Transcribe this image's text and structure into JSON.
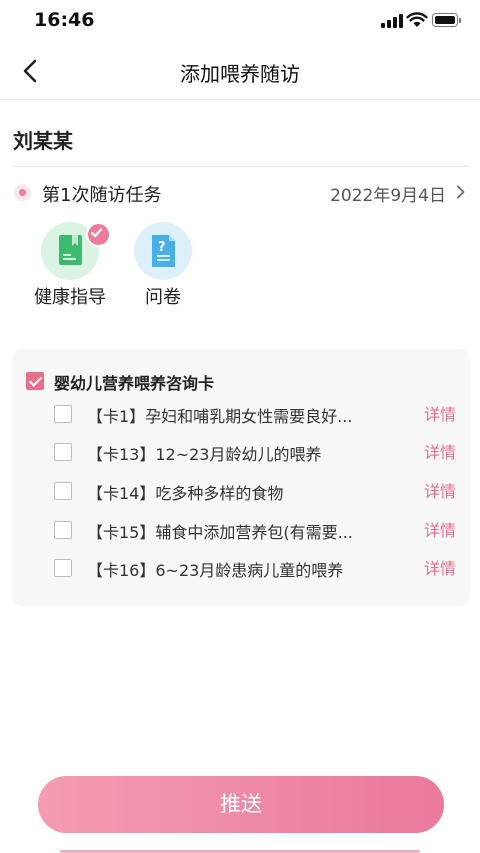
{
  "status_bar": {
    "time": "16:46"
  },
  "nav": {
    "title": "添加喂养随访"
  },
  "patient": {
    "name": "刘某某"
  },
  "task": {
    "title": "第1次随访任务",
    "date": "2022年9月4日"
  },
  "tools": [
    {
      "label": "健康指导",
      "selected": true
    },
    {
      "label": "问卷",
      "selected": false
    }
  ],
  "card_group": {
    "title": "婴幼儿营养喂养咨询卡",
    "checked": true,
    "items": [
      {
        "label": "【卡1】孕妇和哺乳期女性需要良好...",
        "detail": "详情",
        "checked": false
      },
      {
        "label": "【卡13】12~23月龄幼儿的喂养",
        "detail": "详情",
        "checked": false
      },
      {
        "label": "【卡14】吃多种多样的食物",
        "detail": "详情",
        "checked": false
      },
      {
        "label": "【卡15】辅食中添加营养包(有需要...",
        "detail": "详情",
        "checked": false
      },
      {
        "label": "【卡16】6~23月龄患病儿童的喂养",
        "detail": "详情",
        "checked": false
      }
    ]
  },
  "actions": {
    "push_label": "推送"
  },
  "colors": {
    "accent": "#e96f8e",
    "health_bg": "#dbf3e3",
    "survey_bg": "#ddeff8",
    "panel_bg": "#f7f7f8"
  }
}
